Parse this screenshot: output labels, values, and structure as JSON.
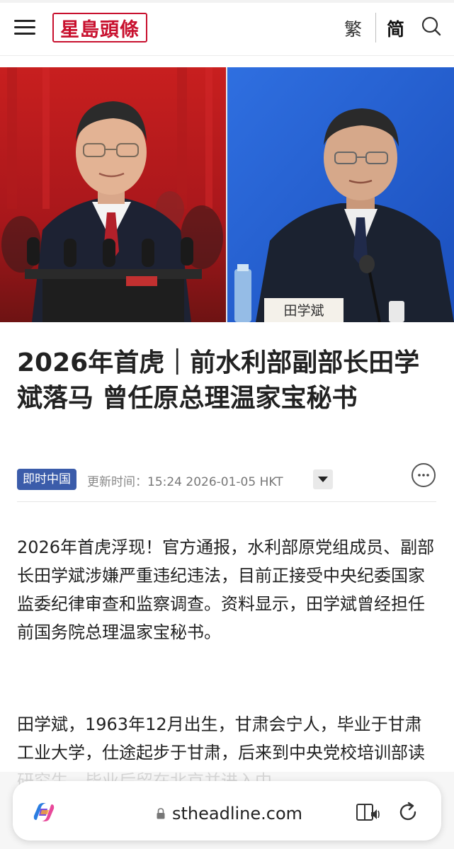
{
  "header": {
    "logo_text": "星島頭條",
    "lang_traditional": "繁",
    "lang_simplified": "简",
    "icons": [
      "menu-icon",
      "search-icon"
    ],
    "brand_color": "#c8102e"
  },
  "hero": {
    "left_placard": "",
    "right_placard": "田学斌"
  },
  "article": {
    "title": "2026年首虎｜前水利部副部长田学斌落马 曾任原总理温家宝秘书",
    "category_badge": "即时中国",
    "updated_label": "更新时间：",
    "updated_value": "15:24 2026-01-05 HKT",
    "paragraphs": [
      "2026年首虎浮现！官方通报，水利部原党组成员、副部长田学斌涉嫌严重违纪违法，目前正接受中央纪委国家监委纪律审查和监察调查。资料显示，田学斌曾经担任前国务院总理温家宝秘书。",
      "田学斌，1963年12月出生，甘肃会宁人，毕业于甘肃工业大学，仕途起步于甘肃，后来到中央党校培训部读研究生，毕业后留在北京并进入中"
    ],
    "badge_color": "#3b5caa"
  },
  "browser": {
    "url": "stheadline.com",
    "icons": [
      "copilot-icon",
      "lock-icon",
      "reader-mode-icon",
      "reload-icon"
    ]
  }
}
